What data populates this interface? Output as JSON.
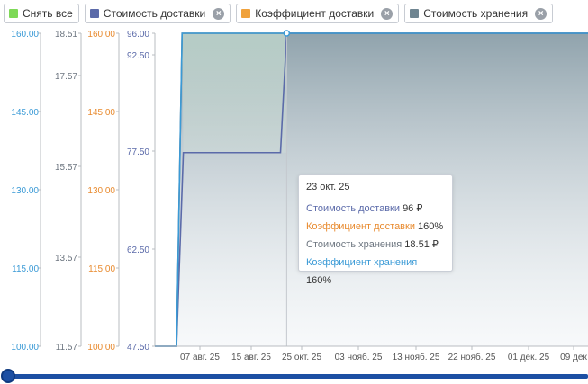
{
  "legend": {
    "select_all": {
      "label": "Снять все",
      "color": "#7ed957"
    },
    "items": [
      {
        "label": "Стоимость доставки",
        "color": "#5b6aa9"
      },
      {
        "label": "Коэффициент доставки",
        "color": "#f0a23c"
      },
      {
        "label": "Стоимость хранения",
        "color": "#6f8591"
      }
    ]
  },
  "tooltip": {
    "date": "23 окт. 25",
    "rows": [
      {
        "label": "Стоимость доставки",
        "value": "96 ₽",
        "color": "#5b6aa9"
      },
      {
        "label": "Коэффициент доставки",
        "value": "160%",
        "color": "#e88a2e"
      },
      {
        "label": "Стоимость хранения",
        "value": "18.51 ₽",
        "color": "#6d7680"
      },
      {
        "label": "Коэффициент хранения",
        "value": "160%",
        "color": "#3a9ad6"
      }
    ]
  },
  "chart_data": {
    "type": "area",
    "x_ticks": [
      "07 авг. 25",
      "15 авг. 25",
      "25 окт. 25",
      "03 нояб. 25",
      "13 нояб. 25",
      "22 нояб. 25",
      "01 дек. 25",
      "09 дек"
    ],
    "axes": [
      {
        "name": "Коэффициент хранения",
        "color": "#3a9ad6",
        "range": [
          100,
          160
        ],
        "ticks": [
          "160.00",
          "145.00",
          "130.00",
          "115.00",
          "100.00"
        ]
      },
      {
        "name": "Стоимость хранения",
        "color": "#6d7680",
        "range": [
          11.57,
          18.51
        ],
        "ticks": [
          "18.51",
          "17.57",
          "15.57",
          "13.57",
          "11.57"
        ]
      },
      {
        "name": "Коэффициент доставки",
        "color": "#e88a2e",
        "range": [
          100,
          160
        ],
        "ticks": [
          "160.00",
          "145.00",
          "130.00",
          "115.00",
          "100.00"
        ]
      },
      {
        "name": "Стоимость доставки",
        "color": "#5b6aa9",
        "range": [
          47.5,
          96
        ],
        "ticks": [
          "96.00",
          "92.50",
          "77.50",
          "62.50",
          "47.50"
        ]
      }
    ],
    "series": [
      {
        "name": "Стоимость доставки",
        "axis": 3,
        "color": "#5b6aa9",
        "points": [
          [
            0,
            47.5
          ],
          [
            3.5,
            47.5
          ],
          [
            4.6,
            77.5
          ],
          [
            20.3,
            77.5
          ],
          [
            21.3,
            96
          ],
          [
            70,
            96
          ]
        ]
      },
      {
        "name": "Стоимость хранения",
        "axis": 1,
        "color": "#6d7680",
        "points": [
          [
            0,
            11.57
          ],
          [
            3.5,
            11.57
          ],
          [
            4.4,
            18.51
          ],
          [
            70,
            18.51
          ]
        ]
      },
      {
        "name": "Коэффициент хранения",
        "axis": 0,
        "color": "#3a9ad6",
        "points": [
          [
            0,
            100
          ],
          [
            3.5,
            100
          ],
          [
            4.4,
            160
          ],
          [
            70,
            160
          ]
        ]
      }
    ],
    "hover": {
      "label": "23 окт. 25",
      "index": 21.3
    }
  }
}
